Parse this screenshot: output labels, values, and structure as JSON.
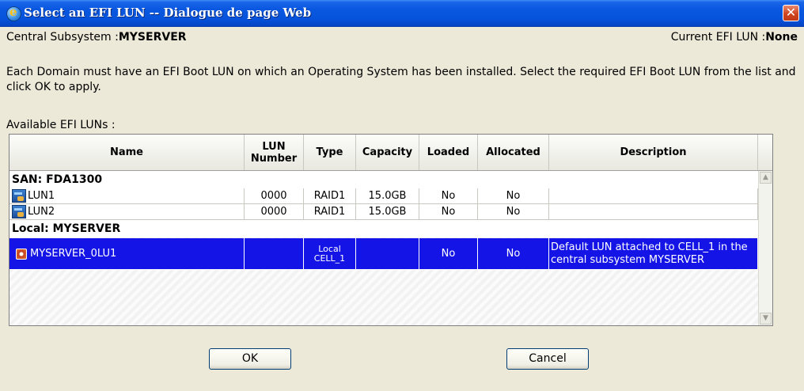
{
  "window": {
    "title": "Select an EFI LUN -- Dialogue de page Web",
    "close_glyph": "✕"
  },
  "header": {
    "subsystem_label": "Central Subsystem :",
    "subsystem_value": "MYSERVER",
    "current_label": "Current EFI LUN :",
    "current_value": "None"
  },
  "instruction": "Each Domain must have an EFI Boot LUN on which an Operating System has been installed. Select the required EFI Boot LUN from the list and click OK to apply.",
  "available_label": "Available EFI LUNs :",
  "table": {
    "columns": [
      "Name",
      "LUN Number",
      "Type",
      "Capacity",
      "Loaded",
      "Allocated",
      "Description"
    ],
    "groups": [
      {
        "label": "SAN: FDA1300",
        "rows": [
          {
            "name": "LUN1",
            "lun_number": "0000",
            "type": "RAID1",
            "capacity": "15.0GB",
            "loaded": "No",
            "allocated": "No",
            "description": "",
            "icon": "san-lun-icon"
          },
          {
            "name": "LUN2",
            "lun_number": "0000",
            "type": "RAID1",
            "capacity": "15.0GB",
            "loaded": "No",
            "allocated": "No",
            "description": "",
            "icon": "san-lun-icon"
          }
        ]
      },
      {
        "label": "Local: MYSERVER",
        "rows": [
          {
            "name": "MYSERVER_0LU1",
            "lun_number": "",
            "type": "Local CELL_1",
            "capacity": "",
            "loaded": "No",
            "allocated": "No",
            "description": "Default LUN attached to CELL_1 in the central subsystem MYSERVER",
            "icon": "local-lun-icon",
            "selected": true
          }
        ]
      }
    ],
    "scroll_up_glyph": "▲",
    "scroll_down_glyph": "▼"
  },
  "buttons": {
    "ok": "OK",
    "cancel": "Cancel"
  },
  "colors": {
    "titlebar": "#0653dc",
    "selection": "#1414e6",
    "dialog_bg": "#ece9d8"
  }
}
